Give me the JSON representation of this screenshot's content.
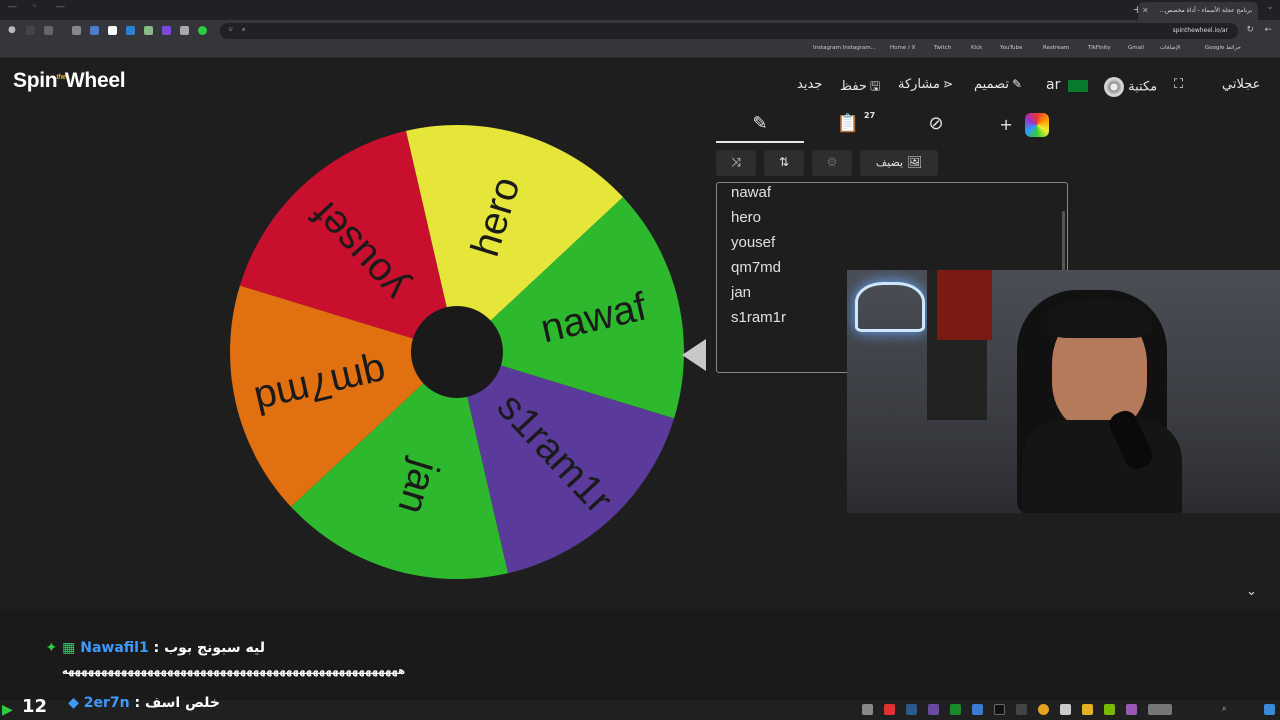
{
  "browser": {
    "tab_title": "برنامج عجلة الأسماء - أداة مخصص...",
    "url": "spinthewheel.io/ar",
    "bookmarks": [
      "Instagram Instagram...",
      "Home / X",
      "Twitch",
      "Kick",
      "YouTube",
      "Restream",
      "TikFinity",
      "Gmail",
      "الإضافات",
      "Google خرائط"
    ]
  },
  "app": {
    "logo_left": "Spin",
    "logo_mid": "the",
    "logo_right": "Wheel",
    "header": {
      "new": "جديد",
      "save": "حفظ",
      "share": "مشاركة",
      "design": "تصميم",
      "lang": "ar",
      "gallery": "مكتبة",
      "my_wheels": "عجلاتي"
    }
  },
  "wheel": {
    "entries": [
      "nawaf",
      "hero",
      "yousef",
      "qm7md",
      "jan",
      "s1ram1r"
    ],
    "segments": [
      {
        "label": "hero",
        "color": "#e5e53a"
      },
      {
        "label": "yousef",
        "color": "#c8102e"
      },
      {
        "label": "qm7md",
        "color": "#e07010"
      },
      {
        "label": "jan",
        "color": "#2eb82e"
      },
      {
        "label": "s1ram1r",
        "color": "#5a3a9a"
      },
      {
        "label": "nawaf",
        "color": "#2eb82e"
      }
    ]
  },
  "panel": {
    "results_count": "27",
    "add_image_label": "يضيف"
  },
  "chat": {
    "line1_user": "Nawafil1",
    "line1_msg": "ليه سبونج بوب :",
    "line2_msg": "هههههههههههههههههههههههههههههههههههههههههههههههههههه",
    "line3_user": "2er7n",
    "line3_msg": "خلص اسف :",
    "viewer_count": "12"
  },
  "colors": {
    "accent_blue": "#3d9bff",
    "bg": "#1e1e1e"
  }
}
